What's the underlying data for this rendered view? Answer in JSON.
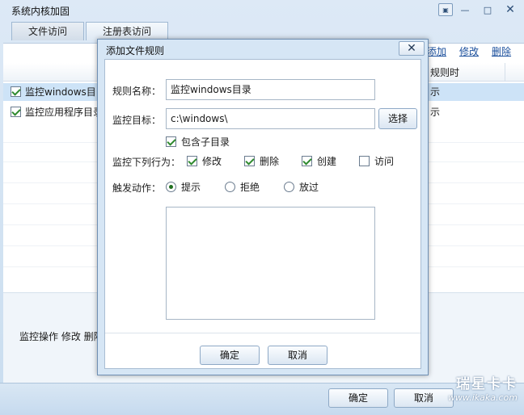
{
  "window": {
    "title": "系统内核加固",
    "controls": {
      "menu": "▣",
      "minimize": "—",
      "maximize": "□",
      "close": "✕"
    }
  },
  "tabs": [
    {
      "label": "文件访问",
      "active": true
    },
    {
      "label": "注册表访问",
      "active": false
    }
  ],
  "toolbar": {
    "add": "添加",
    "edit": "修改",
    "delete": "删除"
  },
  "list": {
    "header_time": "规则时",
    "rows": [
      {
        "name": "监控windows目",
        "time": "示",
        "checked": true,
        "selected": true
      },
      {
        "name": "监控应用程序目录",
        "time": "示",
        "checked": true,
        "selected": false
      }
    ]
  },
  "status_text": "监控操作 修改 删除",
  "footer": {
    "ok": "确定",
    "cancel": "取消"
  },
  "watermark": {
    "brand": "瑞星卡卡",
    "url": "www.ikaka.com"
  },
  "dialog": {
    "title": "添加文件规则",
    "close": "✕",
    "rule_name_label": "规则名称：",
    "rule_name_value": "监控windows目录",
    "target_label": "监控目标：",
    "target_value": "c:\\windows\\",
    "browse": "选择",
    "include_subdirs": {
      "label": "包含子目录",
      "checked": true
    },
    "actions_label": "监控下列行为：",
    "actions": [
      {
        "label": "修改",
        "checked": true
      },
      {
        "label": "删除",
        "checked": true
      },
      {
        "label": "创建",
        "checked": true
      },
      {
        "label": "访问",
        "checked": false
      }
    ],
    "trigger_label": "触发动作：",
    "triggers": [
      {
        "label": "提示",
        "selected": true
      },
      {
        "label": "拒绝",
        "selected": false
      },
      {
        "label": "放过",
        "selected": false
      }
    ],
    "ok": "确定",
    "cancel": "取消"
  },
  "colors": {
    "accent": "#1b4f9c",
    "selection": "#cde3f7",
    "check": "#2f8a2f"
  }
}
